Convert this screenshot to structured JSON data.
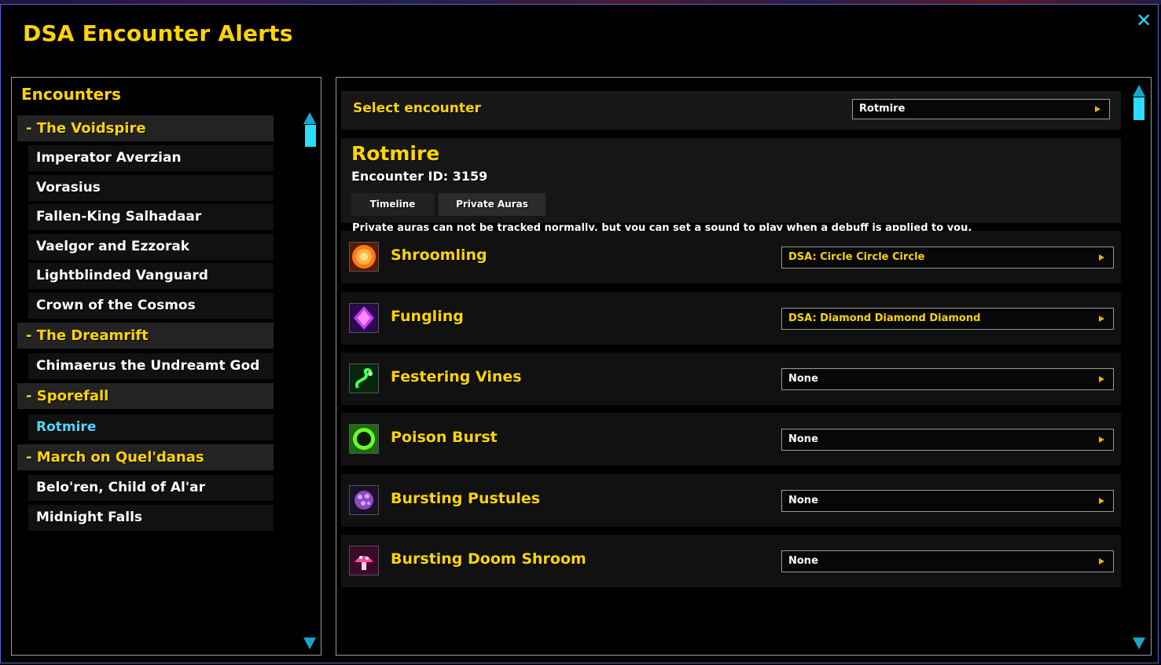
{
  "window": {
    "title": "DSA Encounter Alerts",
    "close_glyph": "✕"
  },
  "encounters_panel": {
    "title": "Encounters",
    "rows": [
      {
        "type": "group",
        "label": "- The Voidspire"
      },
      {
        "type": "boss",
        "label": "Imperator Averzian"
      },
      {
        "type": "boss",
        "label": "Vorasius"
      },
      {
        "type": "boss",
        "label": "Fallen-King Salhadaar"
      },
      {
        "type": "boss",
        "label": "Vaelgor and Ezzorak"
      },
      {
        "type": "boss",
        "label": "Lightblinded Vanguard"
      },
      {
        "type": "boss",
        "label": "Crown of the Cosmos"
      },
      {
        "type": "group",
        "label": "- The Dreamrift"
      },
      {
        "type": "boss",
        "label": "Chimaerus the Undreamt God"
      },
      {
        "type": "group",
        "label": "- Sporefall"
      },
      {
        "type": "boss",
        "label": "Rotmire",
        "selected": true
      },
      {
        "type": "group",
        "label": "- March on Quel'danas"
      },
      {
        "type": "boss",
        "label": "Belo'ren, Child of Al'ar"
      },
      {
        "type": "boss",
        "label": "Midnight Falls"
      }
    ]
  },
  "detail": {
    "select_label": "Select encounter",
    "select_value": "Rotmire",
    "encounter_name": "Rotmire",
    "encounter_id_text": "Encounter ID: 3159",
    "tabs": [
      {
        "label": "Timeline",
        "active": false
      },
      {
        "label": "Private Auras",
        "active": true
      }
    ],
    "note": "Private auras can not be tracked normally, but you can set a sound to play when a debuff is applied to you.",
    "auras": [
      {
        "name": "Shroomling",
        "sound": "DSA: Circle Circle Circle",
        "icon": "orange-orb-icon",
        "highlight": true
      },
      {
        "name": "Fungling",
        "sound": "DSA: Diamond Diamond Diamond",
        "icon": "purple-crystal-icon",
        "highlight": true
      },
      {
        "name": "Festering Vines",
        "sound": "None",
        "icon": "green-vine-icon",
        "highlight": false
      },
      {
        "name": "Poison Burst",
        "sound": "None",
        "icon": "green-ring-icon",
        "highlight": false
      },
      {
        "name": "Bursting Pustules",
        "sound": "None",
        "icon": "purple-spore-icon",
        "highlight": false
      },
      {
        "name": "Bursting Doom Shroom",
        "sound": "None",
        "icon": "pink-shroom-icon",
        "highlight": false
      }
    ]
  },
  "colors": {
    "accent_yellow": "#ffd500",
    "selected_cyan": "#4fd8ff",
    "scrollbar": "#2adcff",
    "frame_border": "#4a63d8"
  }
}
